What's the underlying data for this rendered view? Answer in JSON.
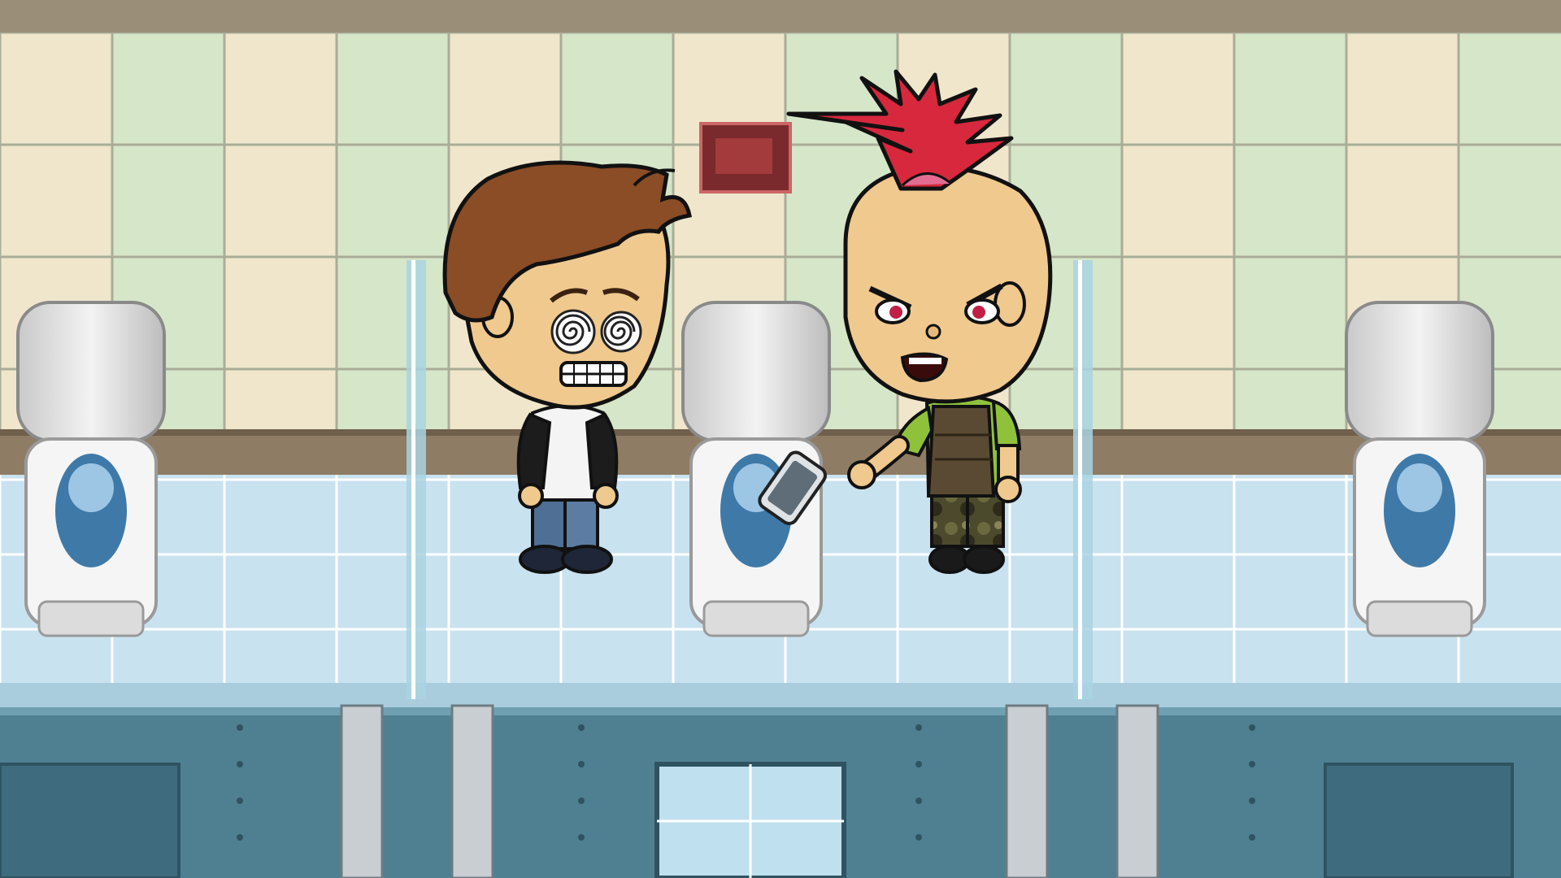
{
  "scene": {
    "setting": "school-restroom",
    "stall_count": 3,
    "dropped_item": "smartphone"
  },
  "characters": [
    {
      "id": "brown-hair-boy",
      "expression": "dizzy-spiral-eyes",
      "outfit": "black-white-raglan-jeans"
    },
    {
      "id": "mohawk-punk",
      "expression": "angry",
      "outfit": "green-shirt-camo-vest-camo-pants"
    }
  ],
  "colors": {
    "wall_tile_cream": "#efe6cc",
    "wall_tile_green": "#d6e6c9",
    "floor_tile": "#c7e0ee",
    "stall_blue": "#4f8092",
    "stall_panel": "#5b8da0",
    "mohawk_red": "#d8283d",
    "hair_brown": "#8a4d26",
    "skin": "#f0c98e",
    "shirt_green": "#8fc23a"
  }
}
